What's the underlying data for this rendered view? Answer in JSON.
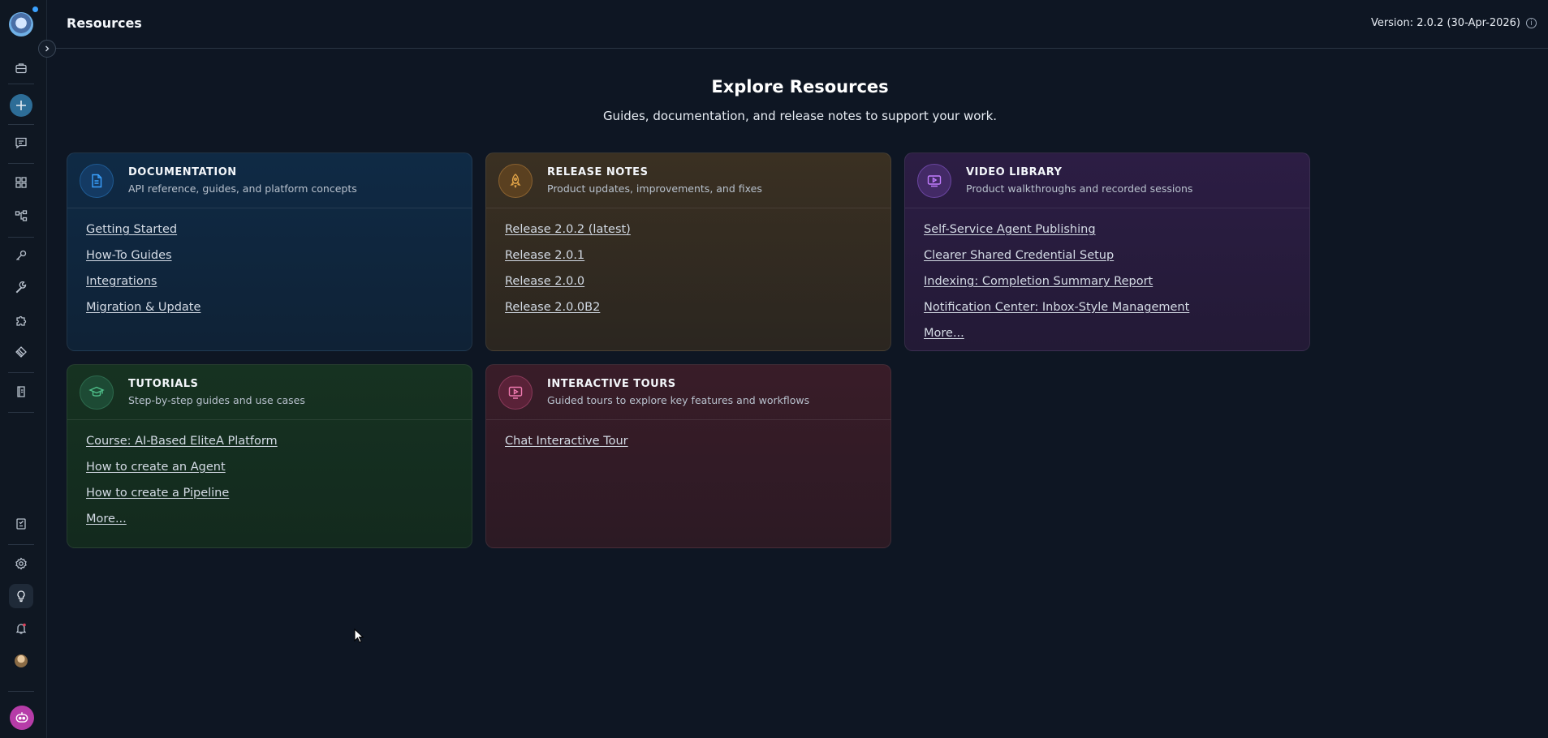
{
  "header": {
    "title": "Resources",
    "version": "Version: 2.0.2 (30-Apr-2026)",
    "info_symbol": "i"
  },
  "sidebar": {
    "icons": [
      "briefcase-icon",
      "plus-icon",
      "chat-icon",
      "grid-icon",
      "flow-icon",
      "key-icon",
      "wrench-icon",
      "puzzle-icon",
      "layers-icon",
      "book-icon",
      "notebook-icon",
      "settings-icon",
      "lightbulb-icon",
      "bell-icon",
      "avatar",
      "bot-icon"
    ],
    "active": "lightbulb-icon"
  },
  "hero": {
    "title": "Explore Resources",
    "subtitle": "Guides, documentation, and release notes to support your work."
  },
  "cards": {
    "documentation": {
      "title": "DOCUMENTATION",
      "desc": "API reference, guides, and platform concepts",
      "links": [
        "Getting Started",
        "How-To Guides",
        "Integrations",
        "Migration & Update"
      ],
      "icon": "document-icon",
      "color": "#1f5a92"
    },
    "release_notes": {
      "title": "RELEASE NOTES",
      "desc": "Product updates, improvements, and fixes",
      "links": [
        "Release 2.0.2 (latest)",
        "Release 2.0.1",
        "Release 2.0.0",
        "Release 2.0.0B2"
      ],
      "icon": "rocket-icon",
      "color": "#c68a3a"
    },
    "video_library": {
      "title": "VIDEO LIBRARY",
      "desc": "Product walkthroughs and recorded sessions",
      "links": [
        "Self-Service Agent Publishing",
        "Clearer Shared Credential Setup",
        "Indexing: Completion Summary Report",
        "Notification Center: Inbox-Style Management",
        "More..."
      ],
      "icon": "video-icon",
      "color": "#a070e0"
    },
    "tutorials": {
      "title": "TUTORIALS",
      "desc": "Step-by-step guides and use cases",
      "links": [
        "Course: AI-Based EliteA Platform",
        "How to create an Agent",
        "How to create a Pipeline",
        "More..."
      ],
      "icon": "graduation-cap-icon",
      "color": "#3fa072"
    },
    "interactive_tours": {
      "title": "INTERACTIVE TOURS",
      "desc": "Guided tours to explore key features and workflows",
      "links": [
        "Chat Interactive Tour"
      ],
      "icon": "play-screen-icon",
      "color": "#e0609a"
    }
  }
}
